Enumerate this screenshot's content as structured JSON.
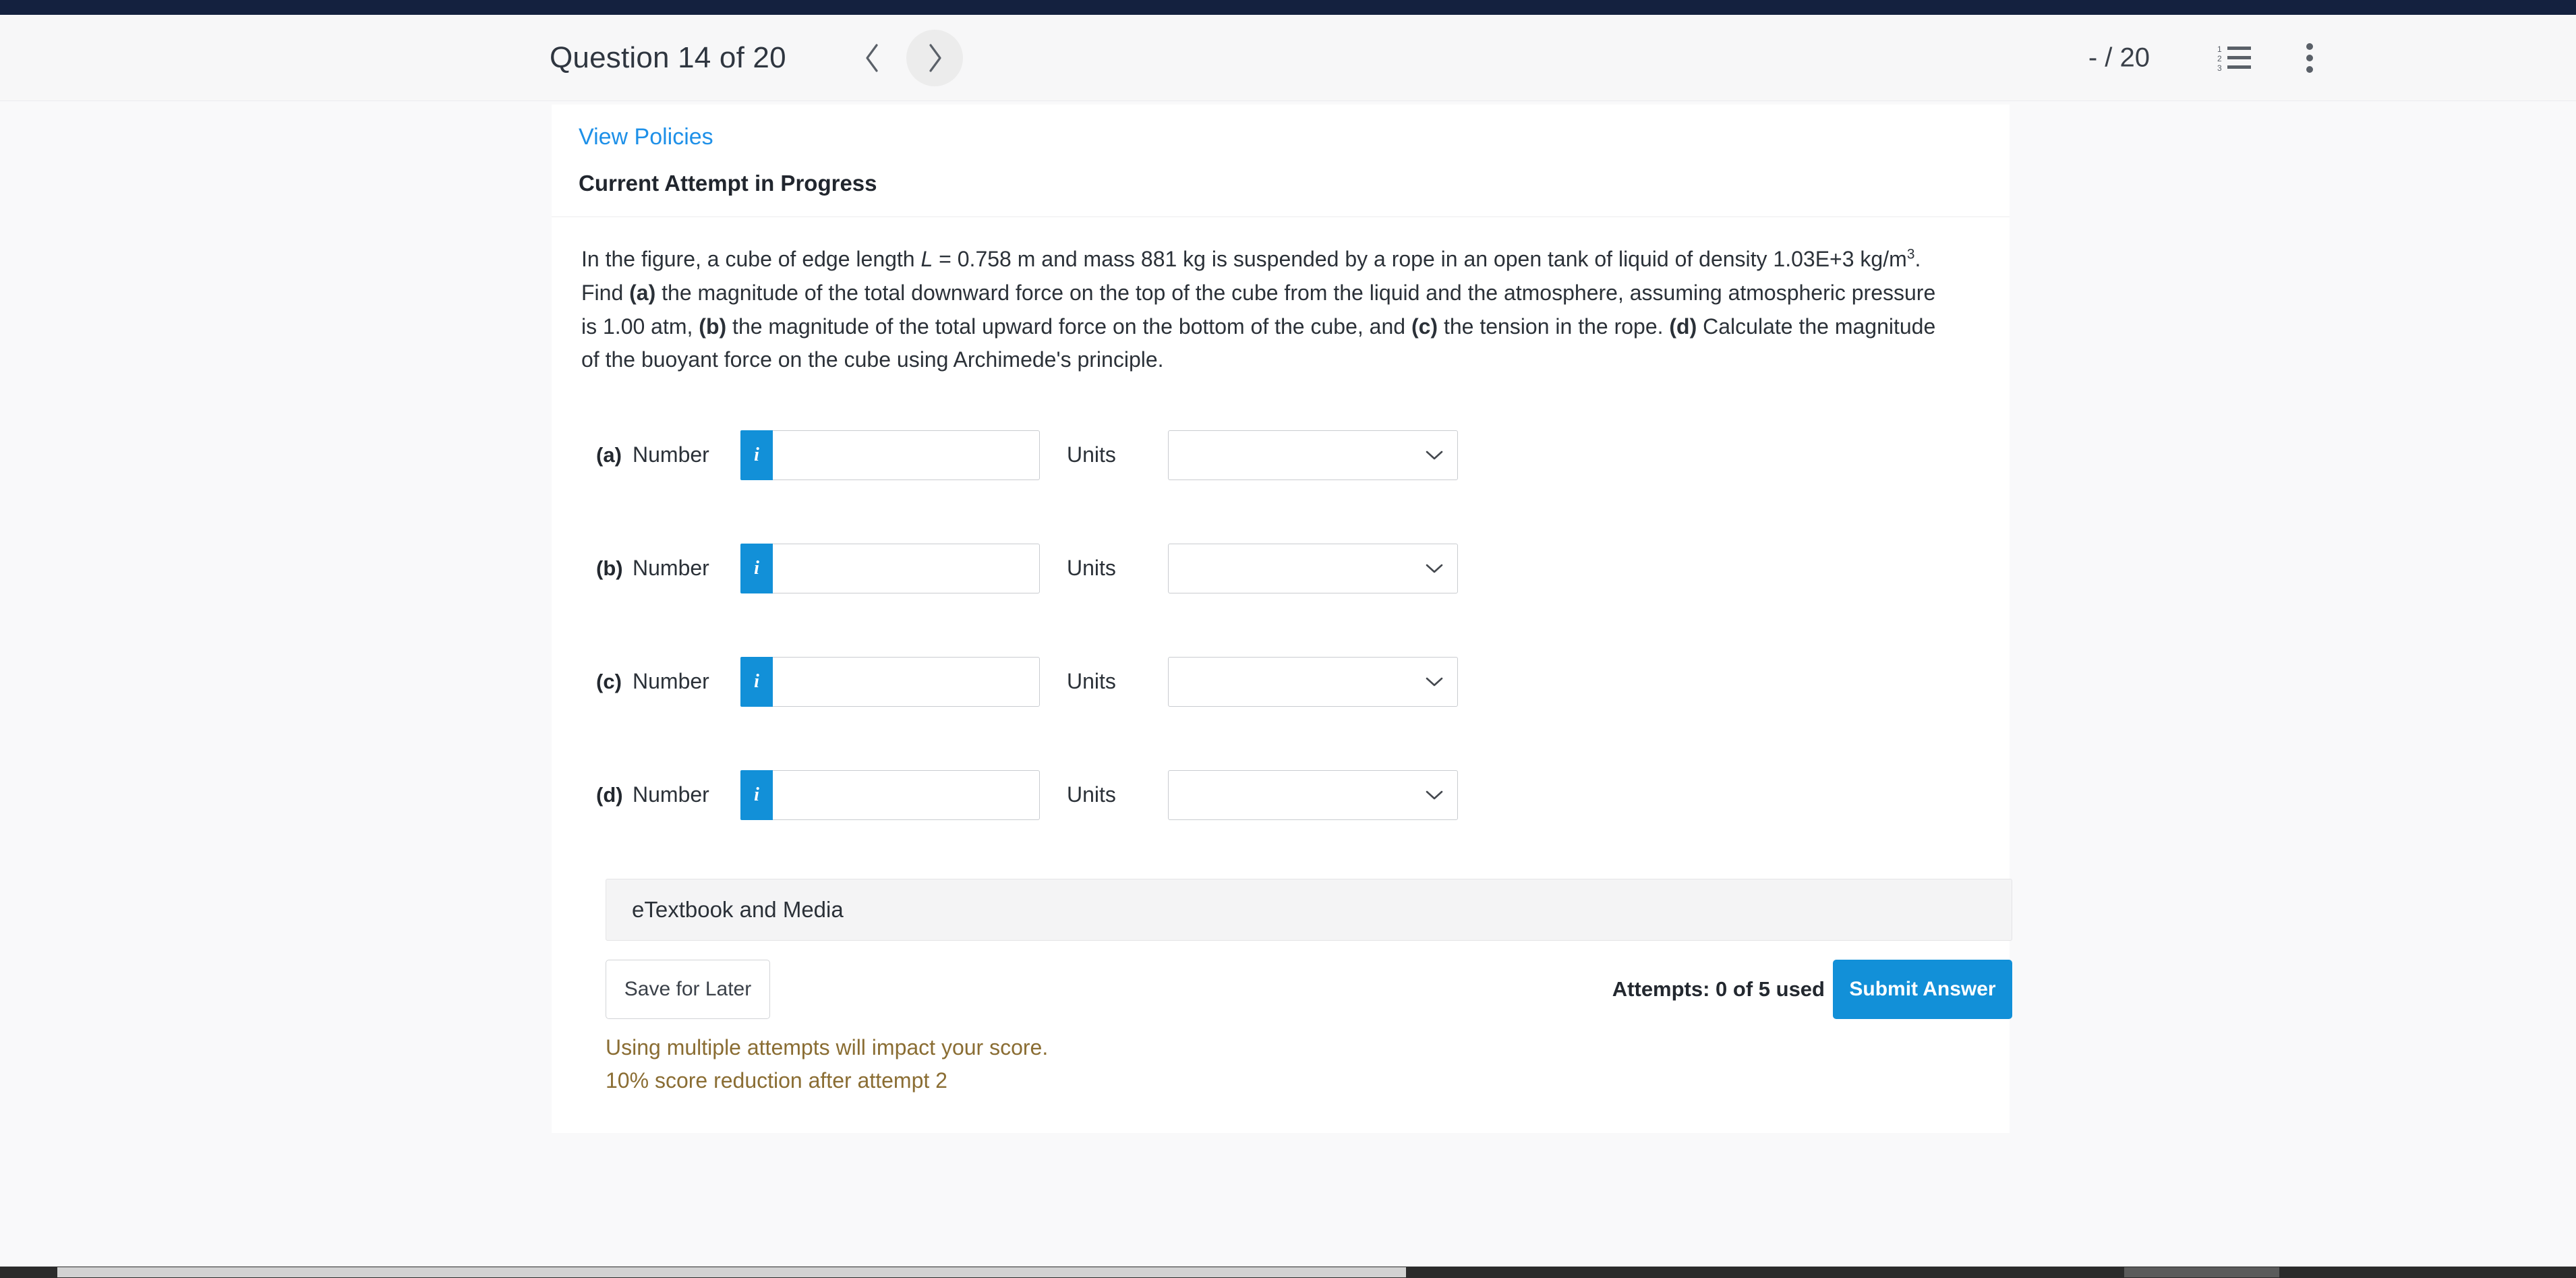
{
  "header": {
    "question_title": "Question 14 of 20",
    "prev_label": "‹",
    "next_label": "›",
    "score": "- / 20",
    "list_icon": "numbered-list-icon",
    "kebab_icon": "more-vertical-icon"
  },
  "card": {
    "view_policies": "View Policies",
    "attempt_title": "Current Attempt in Progress",
    "question_segments": {
      "s1": "In the figure, a cube of edge length ",
      "var_L": "L",
      "s2": " = 0.758 m and mass 881 kg is suspended by a rope in an open tank of liquid of density 1.03E+3 kg/m",
      "sup3": "3",
      "s3": ". Find ",
      "a_tag": "(a)",
      "s4": " the magnitude of the total downward force on the top of the cube from the liquid and the atmosphere, assuming atmospheric pressure is 1.00 atm, ",
      "b_tag": "(b)",
      "s5": " the magnitude of the total upward force on the bottom of the cube, and ",
      "c_tag": "(c)",
      "s6": " the tension in the rope. ",
      "d_tag": "(d)",
      "s7": " Calculate the magnitude of the buoyant force on the cube using Archimede's principle."
    }
  },
  "answers": {
    "number_label": "Number",
    "units_label": "Units",
    "info_glyph": "i",
    "chevron": "chevron-down-icon",
    "rows": [
      {
        "part": "(a)",
        "value": "",
        "placeholder": "",
        "unit_value": "",
        "unit_placeholder": ""
      },
      {
        "part": "(b)",
        "value": "",
        "placeholder": "",
        "unit_value": "",
        "unit_placeholder": ""
      },
      {
        "part": "(c)",
        "value": "",
        "placeholder": "",
        "unit_value": "",
        "unit_placeholder": ""
      },
      {
        "part": "(d)",
        "value": "",
        "placeholder": "",
        "unit_value": "",
        "unit_placeholder": ""
      }
    ]
  },
  "footer": {
    "etextbook": "eTextbook and Media",
    "save_for_later": "Save for Later",
    "attempts": "Attempts: 0 of 5 used",
    "submit": "Submit Answer",
    "warning_1": "Using multiple attempts will impact your score.",
    "warning_2": "10% score reduction after attempt 2"
  },
  "colors": {
    "topbar": "#14213f",
    "accent_blue": "#1290d8",
    "link_blue": "#1e90e8",
    "warning_brown": "#8a6d33"
  }
}
